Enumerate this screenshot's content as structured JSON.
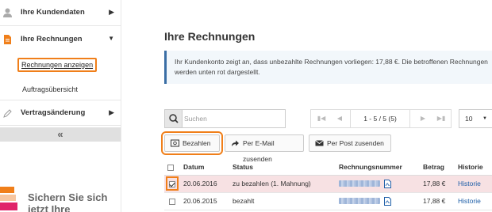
{
  "sidebar": {
    "items": [
      {
        "label": "Ihre Kundendaten",
        "icon": "user-icon",
        "arrow": "chevron-right"
      },
      {
        "label": "Ihre Rechnungen",
        "icon": "document-icon",
        "arrow": "chevron-down"
      },
      {
        "label": "Vertragsänderung",
        "icon": "pencil-icon",
        "arrow": "chevron-right"
      }
    ],
    "subitems": [
      {
        "label": "Rechnungen anzeigen",
        "active": true
      },
      {
        "label": "Auftragsübersicht",
        "active": false
      }
    ],
    "collapse_label": "«",
    "promo_text": "Sichern Sie sich jetzt Ihre"
  },
  "main": {
    "title": "Ihre Rechnungen",
    "info": "Ihr Kundenkonto zeigt an, dass unbezahlte Rechnungen vorliegen: 17,88 €. Die betroffenen Rechnungen werden unten rot dargestellt.",
    "search_placeholder": "Suchen",
    "pager_text": "1 - 5 / 5 (5)",
    "per_page": "10",
    "actions": [
      {
        "label": "Bezahlen",
        "icon": "payment-icon"
      },
      {
        "label": "Per E-Mail zusenden",
        "icon": "share-icon"
      },
      {
        "label": "Per Post zusenden",
        "icon": "envelope-icon"
      }
    ],
    "columns": [
      "Datum",
      "Status",
      "Rechnungsnummer",
      "Betrag",
      "Historie"
    ],
    "rows": [
      {
        "date": "20.06.2016",
        "status": "zu bezahlen (1. Mahnung)",
        "amount": "17,88 €",
        "history": "Historie",
        "checked": true,
        "unpaid": true
      },
      {
        "date": "20.06.2015",
        "status": "bezahlt",
        "amount": "17,88 €",
        "history": "Historie",
        "checked": false,
        "unpaid": false
      }
    ]
  },
  "colors": {
    "accent": "#f07f1a",
    "link": "#1f5fa8",
    "unpaid_row": "#f7e1e3",
    "info_border": "#3a6ea5"
  }
}
